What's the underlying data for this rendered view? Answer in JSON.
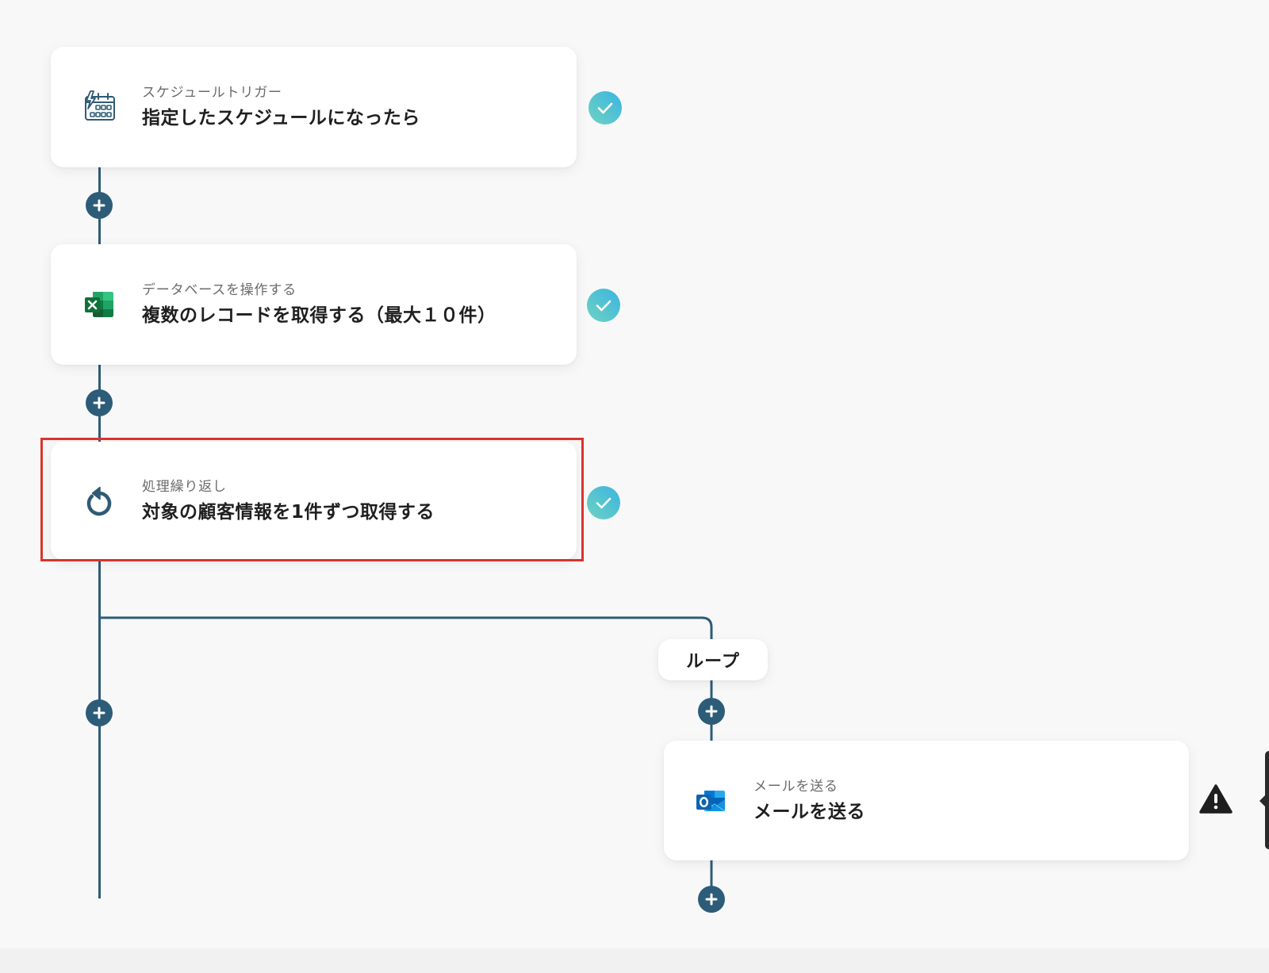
{
  "flow": {
    "nodes": [
      {
        "label": "スケジュールトリガー",
        "title": "指定したスケジュールになったら",
        "icon": "schedule-calendar-icon",
        "status_icon": "check-circle-icon"
      },
      {
        "label": "データベースを操作する",
        "title": "複数のレコードを取得する（最大１０件）",
        "icon": "excel-icon",
        "status_icon": "check-circle-icon"
      },
      {
        "label": "処理繰り返し",
        "title": "対象の顧客情報を1件ずつ取得する",
        "icon": "loop-icon",
        "status_icon": "check-circle-icon",
        "highlighted": true
      },
      {
        "label": "メールを送る",
        "title": "メールを送る",
        "icon": "outlook-icon",
        "status_icon": "warning-triangle-icon"
      }
    ],
    "branch_label": "ループ",
    "add_step_icon": "plus-icon"
  },
  "colors": {
    "background": "#f8f8f8",
    "card": "#ffffff",
    "connector": "#2d5c78",
    "check_gradient_start": "#6fd3c1",
    "check_gradient_end": "#3ab4e2",
    "highlight_outline": "#d9342b",
    "warning": "#1e1e1e"
  }
}
